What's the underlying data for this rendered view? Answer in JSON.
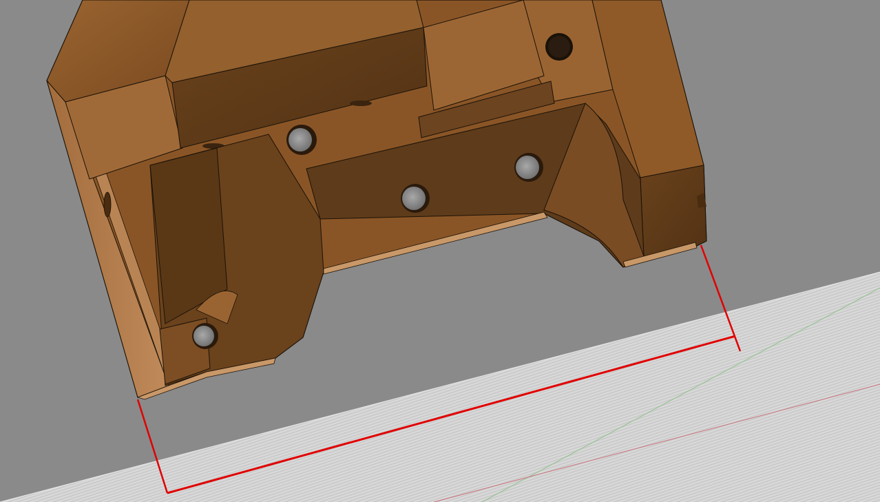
{
  "viewport": {
    "background_color": "#8a8a8a",
    "ground_plane_color": "#d6d6d6",
    "part_color": "#8a5526",
    "part_shadow_color": "#5e3b1a",
    "part_highlight_color": "#a06a38",
    "edge_color": "#1a1208",
    "dimension_color": "#e00000",
    "axis_x_color": "#c9707a",
    "axis_y_color": "#8fc08a"
  },
  "icons": {
    "part": "3d-part-body",
    "dimension": "linear-dimension",
    "ground": "ground-plane",
    "axes": "origin-axes"
  }
}
